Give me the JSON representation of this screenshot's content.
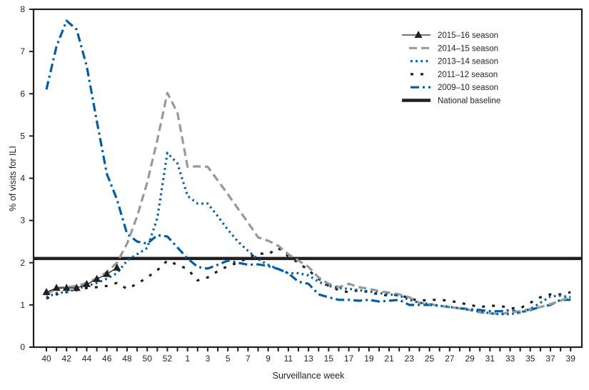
{
  "chart_data": {
    "type": "line",
    "title": "",
    "xlabel": "Surveillance week",
    "ylabel": "% of visits for ILI",
    "ylim": [
      0,
      8
    ],
    "yticks": [
      0,
      1,
      2,
      3,
      4,
      5,
      6,
      7,
      8
    ],
    "grid": false,
    "legend_position": "top-right",
    "x": [
      40,
      41,
      42,
      43,
      44,
      45,
      46,
      47,
      48,
      49,
      50,
      51,
      52,
      53,
      1,
      2,
      3,
      4,
      5,
      6,
      7,
      8,
      9,
      10,
      11,
      12,
      13,
      14,
      15,
      16,
      17,
      18,
      19,
      20,
      21,
      22,
      23,
      24,
      25,
      26,
      27,
      28,
      29,
      30,
      31,
      32,
      33,
      34,
      35,
      36,
      37,
      38,
      39
    ],
    "xtick_labels": [
      "40",
      "",
      "42",
      "",
      "44",
      "",
      "46",
      "",
      "48",
      "",
      "50",
      "",
      "52",
      "",
      "1",
      "",
      "3",
      "",
      "5",
      "",
      "7",
      "",
      "9",
      "",
      "11",
      "",
      "13",
      "",
      "15",
      "",
      "17",
      "",
      "19",
      "",
      "21",
      "",
      "23",
      "",
      "25",
      "",
      "27",
      "",
      "29",
      "",
      "31",
      "",
      "33",
      "",
      "35",
      "",
      "37",
      "",
      "39"
    ],
    "series": [
      {
        "name": "2015–16 season",
        "color": "#231f20",
        "style": "solid-triangle",
        "values": [
          1.3,
          1.4,
          1.4,
          1.4,
          1.49,
          1.61,
          1.73,
          1.88,
          null,
          null,
          null,
          null,
          null,
          null,
          null,
          null,
          null,
          null,
          null,
          null,
          null,
          null,
          null,
          null,
          null,
          null,
          null,
          null,
          null,
          null,
          null,
          null,
          null,
          null,
          null,
          null,
          null,
          null,
          null,
          null,
          null,
          null,
          null,
          null,
          null,
          null,
          null,
          null,
          null,
          null,
          null,
          null,
          null
        ]
      },
      {
        "name": "2014–15 season",
        "color": "#999999",
        "style": "dashed",
        "values": [
          1.24,
          1.4,
          1.42,
          1.45,
          1.52,
          1.63,
          1.78,
          2.0,
          2.45,
          3.1,
          3.9,
          4.9,
          6.02,
          5.55,
          4.27,
          4.28,
          4.27,
          3.95,
          3.62,
          3.28,
          2.95,
          2.6,
          2.52,
          2.4,
          2.2,
          2.05,
          1.9,
          1.65,
          1.5,
          1.42,
          1.5,
          1.42,
          1.38,
          1.33,
          1.29,
          1.25,
          1.18,
          1.05,
          1.02,
          0.98,
          0.95,
          0.92,
          0.88,
          0.82,
          0.8,
          0.79,
          0.82,
          0.85,
          0.9,
          0.95,
          1.02,
          1.1,
          1.2
        ]
      },
      {
        "name": "2013–14 season",
        "color": "#005da6",
        "style": "dotted",
        "values": [
          1.18,
          1.28,
          1.3,
          1.38,
          1.45,
          1.52,
          1.62,
          1.75,
          2.05,
          2.2,
          2.35,
          3.05,
          4.6,
          4.35,
          3.58,
          3.4,
          3.4,
          3.1,
          2.78,
          2.5,
          2.28,
          2.08,
          1.95,
          1.85,
          1.75,
          1.75,
          1.7,
          1.55,
          1.45,
          1.4,
          1.38,
          1.35,
          1.32,
          1.28,
          1.25,
          1.22,
          1.12,
          1.05,
          1.02,
          0.98,
          0.95,
          0.92,
          0.88,
          0.85,
          0.8,
          0.78,
          0.78,
          0.82,
          0.9,
          1.05,
          1.2,
          1.22,
          1.18
        ]
      },
      {
        "name": "2011–12 season",
        "color": "#231f20",
        "style": "dashed-short",
        "values": [
          1.15,
          1.25,
          1.3,
          1.35,
          1.4,
          1.42,
          1.45,
          1.52,
          1.38,
          1.5,
          1.65,
          1.82,
          2.05,
          null,
          1.85,
          1.58,
          1.65,
          1.8,
          1.92,
          2.0,
          2.12,
          2.22,
          2.2,
          2.35,
          2.15,
          2.0,
          1.82,
          1.62,
          1.45,
          1.35,
          1.3,
          1.35,
          1.3,
          1.25,
          1.22,
          1.25,
          1.15,
          1.1,
          1.12,
          1.12,
          1.1,
          1.05,
          1.0,
          0.95,
          0.98,
          0.98,
          0.92,
          0.92,
          1.05,
          1.18,
          1.25,
          1.25,
          1.3
        ]
      },
      {
        "name": "2009–10 season",
        "color": "#005da6",
        "style": "dash-dot",
        "values": [
          6.1,
          7.12,
          7.73,
          7.52,
          6.65,
          5.35,
          4.1,
          3.5,
          2.68,
          2.5,
          2.45,
          2.65,
          2.62,
          null,
          2.1,
          1.9,
          1.86,
          1.95,
          2.05,
          2.0,
          1.95,
          1.96,
          1.92,
          1.85,
          1.75,
          1.55,
          1.5,
          1.25,
          1.18,
          1.12,
          1.12,
          1.1,
          1.12,
          1.08,
          1.1,
          1.12,
          1.0,
          1.0,
          1.0,
          0.98,
          0.95,
          0.92,
          0.9,
          0.88,
          0.85,
          0.85,
          0.88,
          0.82,
          0.88,
          0.95,
          1.0,
          1.12,
          1.12
        ]
      },
      {
        "name": "National baseline",
        "color": "#231f20",
        "style": "solid-thick",
        "value": 2.1
      }
    ]
  }
}
